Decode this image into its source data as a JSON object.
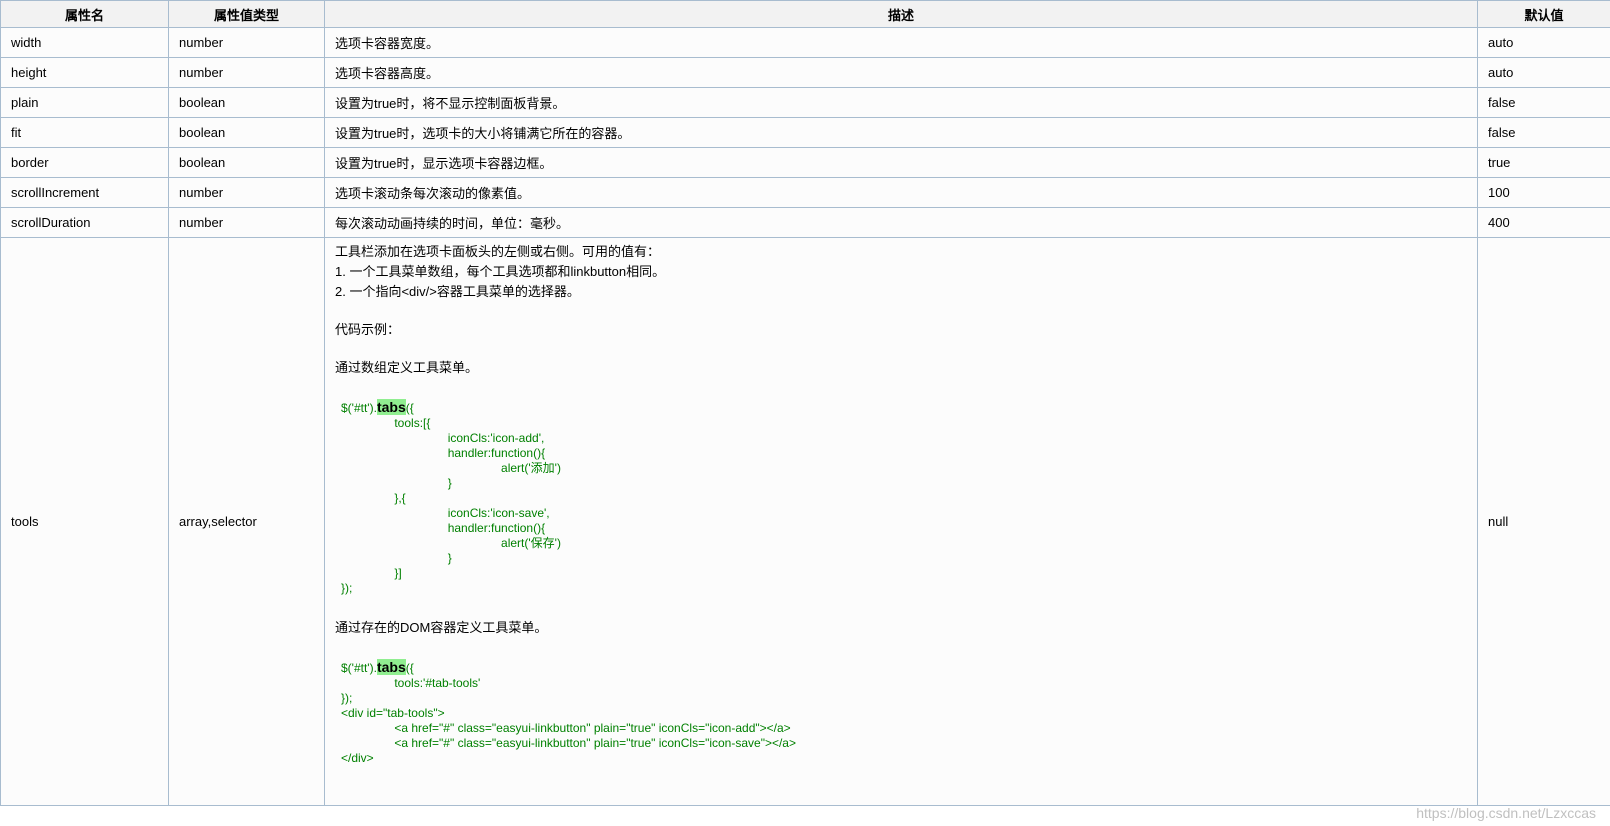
{
  "headers": {
    "name": "属性名",
    "type": "属性值类型",
    "desc": "描述",
    "default": "默认值"
  },
  "rows": [
    {
      "name": "width",
      "type": "number",
      "desc": "选项卡容器宽度。",
      "default": "auto"
    },
    {
      "name": "height",
      "type": "number",
      "desc": "选项卡容器高度。",
      "default": "auto"
    },
    {
      "name": "plain",
      "type": "boolean",
      "desc": "设置为true时，将不显示控制面板背景。",
      "default": "false"
    },
    {
      "name": "fit",
      "type": "boolean",
      "desc": "设置为true时，选项卡的大小将铺满它所在的容器。",
      "default": "false"
    },
    {
      "name": "border",
      "type": "boolean",
      "desc": "设置为true时，显示选项卡容器边框。",
      "default": "true"
    },
    {
      "name": "scrollIncrement",
      "type": "number",
      "desc": "选项卡滚动条每次滚动的像素值。",
      "default": "100"
    },
    {
      "name": "scrollDuration",
      "type": "number",
      "desc": "每次滚动动画持续的时间，单位：毫秒。",
      "default": "400"
    }
  ],
  "tools_row": {
    "name": "tools",
    "type": "array,selector",
    "default": "null",
    "intro": [
      "工具栏添加在选项卡面板头的左侧或右侧。可用的值有：",
      "1. 一个工具菜单数组，每个工具选项都和linkbutton相同。",
      "2. 一个指向<div/>容器工具菜单的选择器。"
    ],
    "example_label": "代码示例：",
    "example1_label": "通过数组定义工具菜单。",
    "code1_prefix": "$('#tt').",
    "code1_keyword": "tabs",
    "code1_rest": "({\n\t\ttools:[{\n\t\t\t\ticonCls:'icon-add',\n\t\t\t\thandler:function(){\n\t\t\t\t\t\talert('添加')\n\t\t\t\t}\n\t\t},{\n\t\t\t\ticonCls:'icon-save',\n\t\t\t\thandler:function(){\n\t\t\t\t\t\talert('保存')\n\t\t\t\t}\n\t\t}]\n});",
    "example2_label": "通过存在的DOM容器定义工具菜单。",
    "code2_prefix": "$('#tt').",
    "code2_keyword": "tabs",
    "code2_rest": "({\n\t\ttools:'#tab-tools'\n});\n<div id=\"tab-tools\">\n\t\t<a href=\"#\" class=\"easyui-linkbutton\" plain=\"true\" iconCls=\"icon-add\"></a>\n\t\t<a href=\"#\" class=\"easyui-linkbutton\" plain=\"true\" iconCls=\"icon-save\"></a>\n</div>"
  },
  "watermark": "https://blog.csdn.net/Lzxccas"
}
